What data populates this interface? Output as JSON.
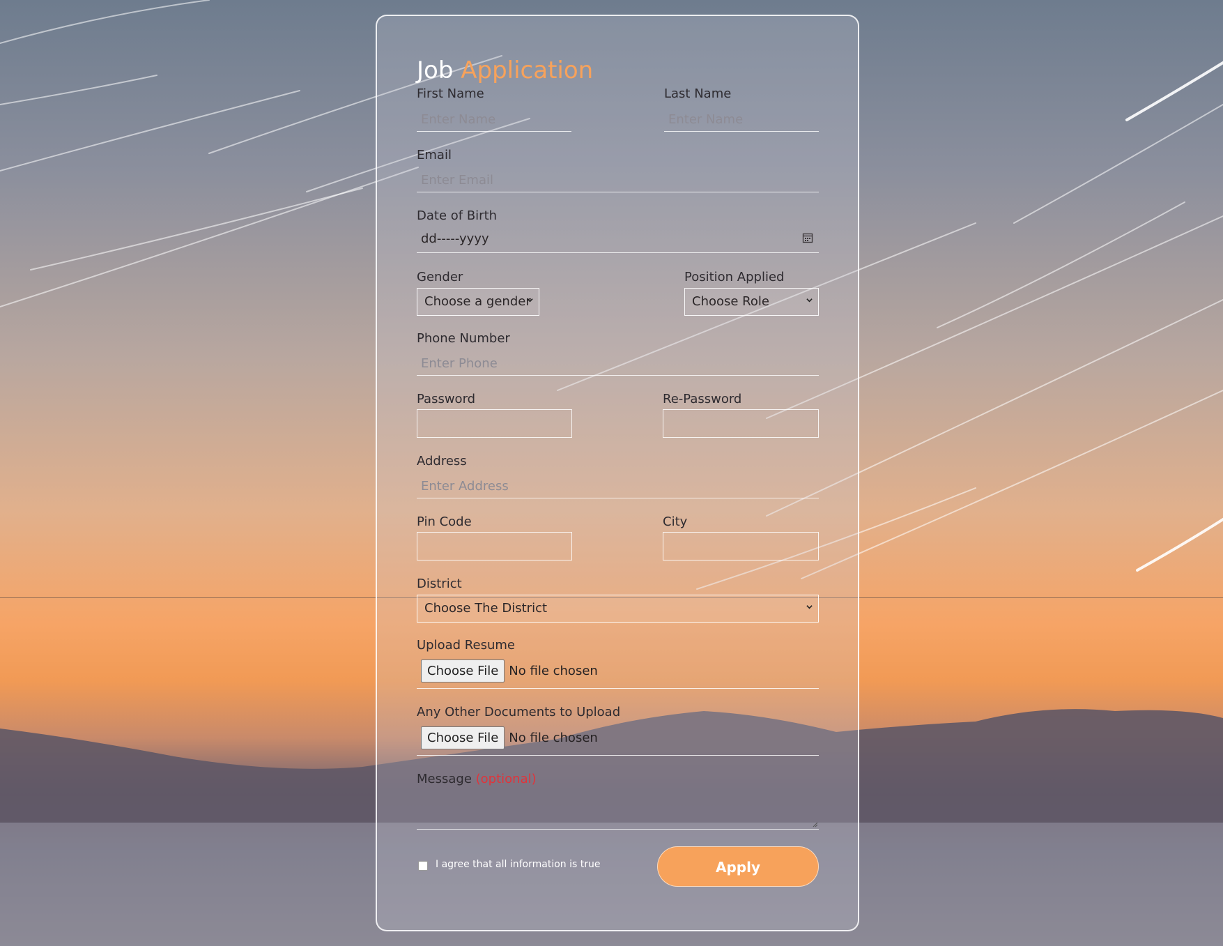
{
  "form": {
    "title_part1": "Job",
    "title_part2": "Application",
    "first_name": {
      "label": "First Name",
      "placeholder": "Enter Name"
    },
    "last_name": {
      "label": "Last Name",
      "placeholder": "Enter Name"
    },
    "email": {
      "label": "Email",
      "placeholder": "Enter Email"
    },
    "dob": {
      "label": "Date of Birth",
      "value": "dd-----yyyy"
    },
    "gender": {
      "label": "Gender",
      "selected": "Choose a gender"
    },
    "position": {
      "label": "Position Applied",
      "selected": "Choose Role"
    },
    "phone": {
      "label": "Phone Number",
      "placeholder": "Enter Phone"
    },
    "password": {
      "label": "Password"
    },
    "re_password": {
      "label": "Re-Password"
    },
    "address": {
      "label": "Address",
      "placeholder": "Enter Address"
    },
    "pin_code": {
      "label": "Pin Code"
    },
    "city": {
      "label": "City"
    },
    "district": {
      "label": "District",
      "selected": "Choose The District"
    },
    "resume": {
      "label": "Upload Resume",
      "button": "Choose File",
      "status": "No file chosen"
    },
    "other_docs": {
      "label": "Any Other Documents to Upload",
      "button": "Choose File",
      "status": "No file chosen"
    },
    "message": {
      "label": "Message",
      "optional": "(optional)"
    },
    "agree_label": "I agree that all information is true",
    "apply_label": "Apply"
  },
  "colors": {
    "accent": "#f7a25b",
    "optional": "#e0343b"
  }
}
